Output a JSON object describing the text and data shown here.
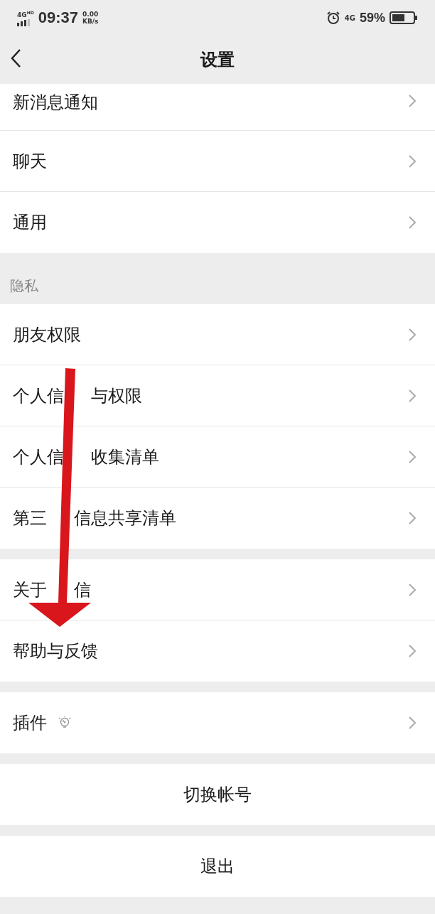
{
  "status_bar": {
    "network": "4G",
    "network_sup": "HD",
    "time": "09:37",
    "speed": "0.00",
    "speed_unit": "KB/s",
    "mobile": "4G",
    "battery": "59%"
  },
  "nav": {
    "title": "设置"
  },
  "groups": [
    {
      "cut": true,
      "items": [
        {
          "label": "新消息通知"
        },
        {
          "label": "聊天"
        },
        {
          "label": "通用"
        }
      ]
    },
    {
      "header": "隐私",
      "items": [
        {
          "label": "朋友权限"
        },
        {
          "label_parts": [
            "个人信",
            "与权限"
          ]
        },
        {
          "label_parts": [
            "个人信",
            "收集清单"
          ]
        },
        {
          "label_parts": [
            "第三",
            "信息共享清单"
          ]
        }
      ]
    },
    {
      "items": [
        {
          "label_parts": [
            "关于",
            "信"
          ]
        },
        {
          "label": "帮助与反馈"
        }
      ]
    },
    {
      "items": [
        {
          "label": "插件",
          "kind": "plugin"
        }
      ]
    }
  ],
  "actions": [
    "切换帐号",
    "退出"
  ]
}
